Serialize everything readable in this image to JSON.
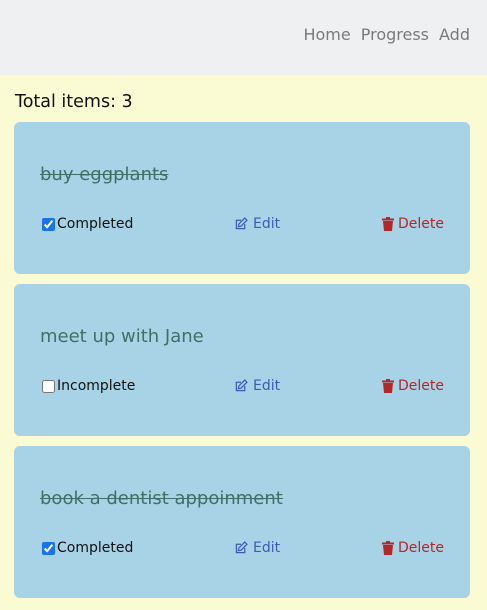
{
  "nav": {
    "links": [
      "Home",
      "Progress",
      "Add"
    ]
  },
  "summary": {
    "total_label": "Total items: 3"
  },
  "todos": [
    {
      "title": "buy eggplants",
      "status": "Completed",
      "checked": true,
      "edit": "Edit",
      "delete": "Delete"
    },
    {
      "title": "meet up with Jane",
      "status": "Incomplete",
      "checked": false,
      "edit": "Edit",
      "delete": "Delete"
    },
    {
      "title": "book a dentist appoinment",
      "status": "Completed",
      "checked": true,
      "edit": "Edit",
      "delete": "Delete"
    }
  ],
  "colors": {
    "page_bg": "#fafad3",
    "nav_bg": "#eff0f2",
    "card_bg": "#a8d3e7",
    "title": "#3f6f67",
    "edit": "#3d5bb5",
    "delete": "#b22828"
  },
  "icons": {
    "edit": "pencil-square-icon",
    "delete": "trash-icon"
  }
}
